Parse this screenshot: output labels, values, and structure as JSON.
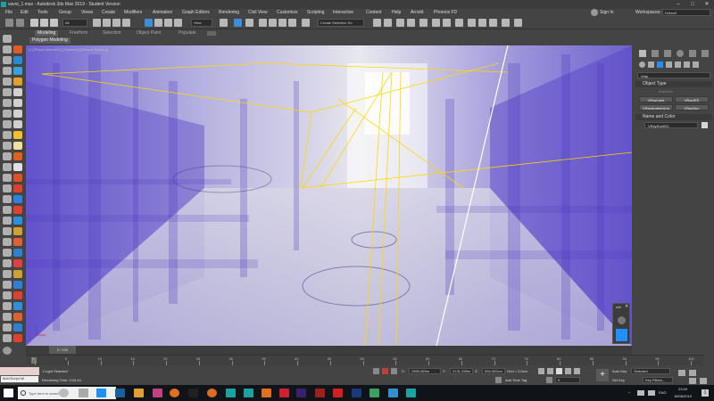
{
  "window": {
    "title": "savoi_1.max - Autodesk 3ds Max 2019 - Student Version",
    "controls": [
      "–",
      "□",
      "✕"
    ]
  },
  "menu": [
    "File",
    "Edit",
    "Tools",
    "Group",
    "Views",
    "Create",
    "Modifiers",
    "Animation",
    "Graph Editors",
    "Rendering",
    "Civil View",
    "Customize",
    "Scripting",
    "Interactive",
    "Content",
    "Help",
    "Arnold",
    "Phoenix FD"
  ],
  "account": {
    "sign_in": "Sign In",
    "workspaces_label": "Workspaces:",
    "workspaces_value": "Default"
  },
  "toolbar": {
    "filter_value": "All",
    "view_value": "View",
    "selection_set_placeholder": "Create Selection Se"
  },
  "ribbon": {
    "tabs": [
      "Modeling",
      "Freeform",
      "Selection",
      "Object Paint",
      "Populate"
    ],
    "active_tab": "Modeling",
    "sub_tab": "Polygon Modeling"
  },
  "viewport": {
    "label": "[+] [PhysCamera001] [Standard] [Default Shading]"
  },
  "command_panel": {
    "dropdown": "Vray",
    "object_type_header": "Object Type",
    "autogrid_label": "AutoGrid",
    "buttons": [
      "VRayLight",
      "VRayIES",
      "VRayAmbientLig",
      "VRaySun"
    ],
    "name_color_header": "Name and Color",
    "object_name": "VRaySun001",
    "object_color": "#d8d8d8"
  },
  "mini_window": {
    "title": "win"
  },
  "timeline": {
    "slider_label": "0 / 100",
    "ticks": [
      "0",
      "5",
      "10",
      "15",
      "20",
      "25",
      "30",
      "35",
      "40",
      "45",
      "50",
      "55",
      "60",
      "65",
      "70",
      "75",
      "80",
      "85",
      "90",
      "95",
      "100"
    ]
  },
  "statusbar": {
    "maxscript_placeholder": "MAXScript Mi",
    "selection_info": "1 Light Selected",
    "render_time": "Rendering Time: 0:03:44",
    "x_label": "X:",
    "x_value": "2959,369m",
    "y_label": "Y:",
    "y_value": "2131,335m",
    "z_label": "Z:",
    "z_value": "534,302cm",
    "grid": "Grid = 0,0cm",
    "add_time_tag": "Add Time Tag",
    "auto_key": "Auto Key",
    "set_key": "Set Key",
    "selected_value": "Selected",
    "key_filters": "Key Filters...",
    "frame_value": "0"
  },
  "taskbar": {
    "search_placeholder": "Type here to search",
    "language": "ENG",
    "time": "23:49",
    "date": "18/08/2019",
    "notification_count": "1"
  },
  "colors": {
    "accent": "#1e90ff",
    "viewport_purple": "#6a5cd0",
    "selection_yellow": "#ffd800"
  }
}
